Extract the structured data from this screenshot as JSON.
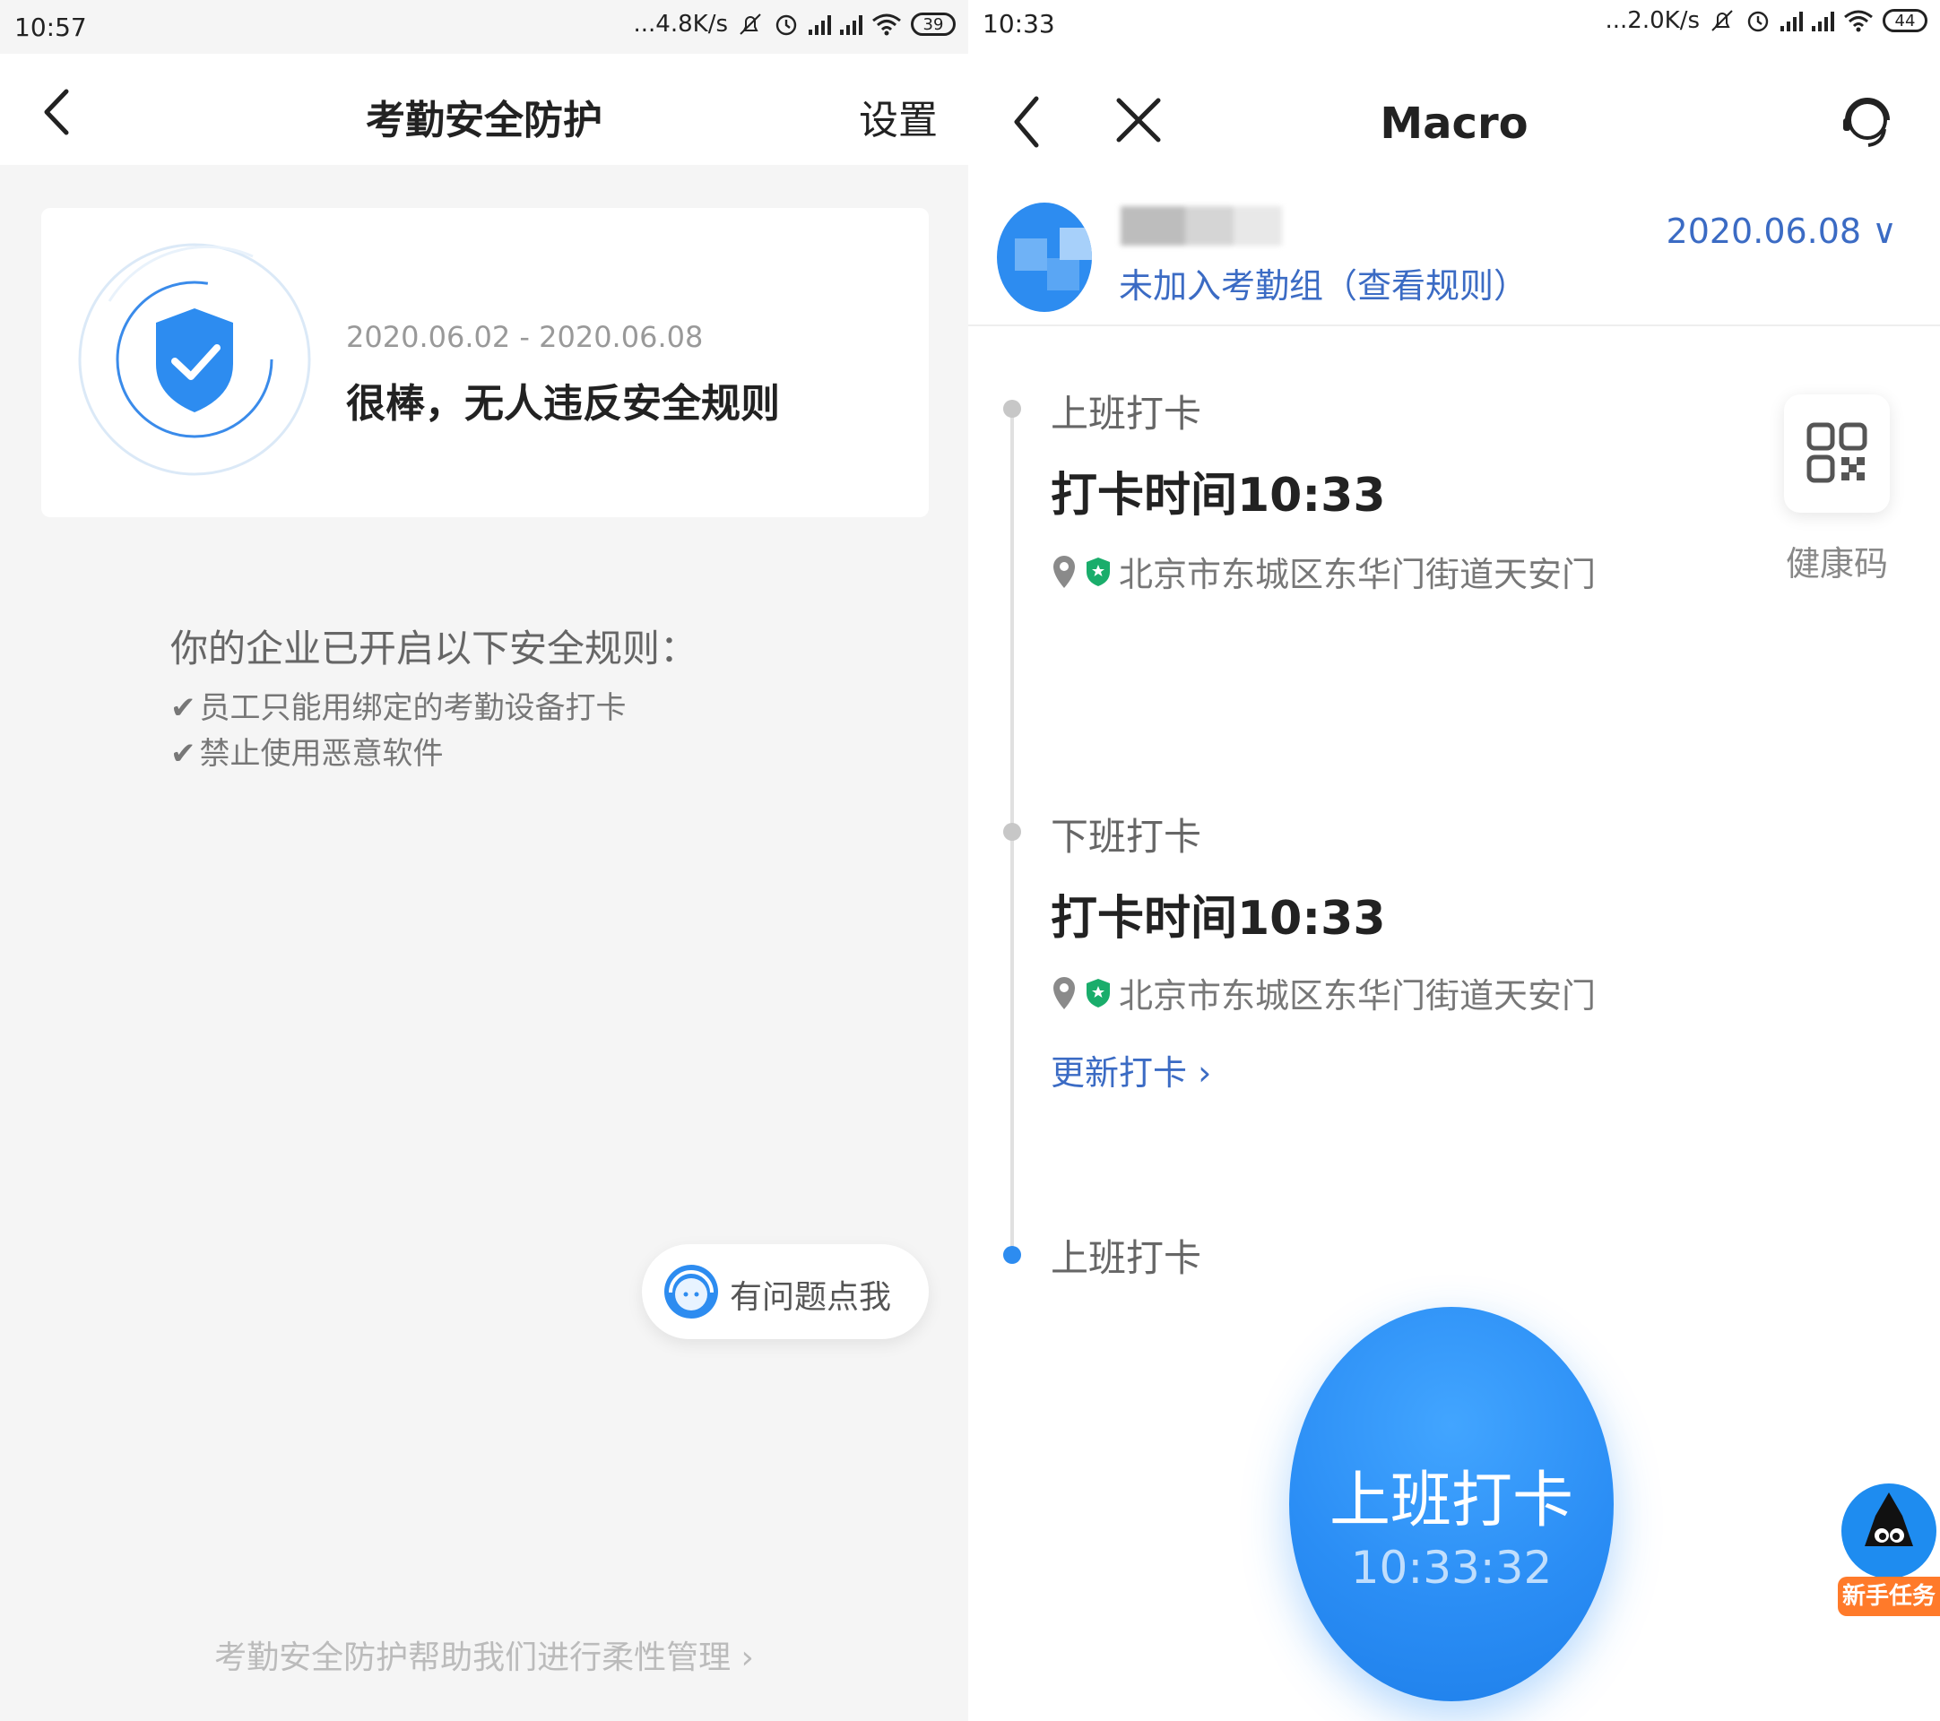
{
  "left": {
    "status": {
      "time": "10:57",
      "net": "...4.8K/s",
      "battery": "39"
    },
    "header": {
      "title": "考勤安全防护",
      "settings": "设置"
    },
    "card": {
      "date_range": "2020.06.02 - 2020.06.08",
      "message": "很棒，无人违反安全规则"
    },
    "rules": {
      "title": "你的企业已开启以下安全规则：",
      "items": [
        {
          "check": "✔",
          "text": "员工只能用绑定的考勤设备打卡"
        },
        {
          "check": "✔",
          "text": "禁止使用恶意软件"
        }
      ]
    },
    "help_button": {
      "label": "有问题点我"
    },
    "footer": {
      "link": "考勤安全防护帮助我们进行柔性管理 ›"
    }
  },
  "right": {
    "status": {
      "time": "10:33",
      "net": "...2.0K/s",
      "battery": "44"
    },
    "header": {
      "title": "Macro"
    },
    "profile": {
      "group_text": "未加入考勤组（查看规则）",
      "date": "2020.06.08 ∨"
    },
    "timeline": [
      {
        "label": "上班打卡",
        "time": "打卡时间10:33",
        "location": "北京市东城区东华门街道天安门"
      },
      {
        "label": "下班打卡",
        "time": "打卡时间10:33",
        "location": "北京市东城区东华门街道天安门",
        "update": "更新打卡 ›"
      },
      {
        "label": "上班打卡"
      }
    ],
    "health_code": {
      "label": "健康码"
    },
    "clock_button": {
      "label": "上班打卡",
      "time": "10:33:32"
    },
    "newbie_task": {
      "label": "新手任务"
    }
  },
  "colors": {
    "accent": "#2d8cf0",
    "link": "#3b6bc4",
    "orange": "#ff7a2a",
    "green": "#1aad6b"
  }
}
